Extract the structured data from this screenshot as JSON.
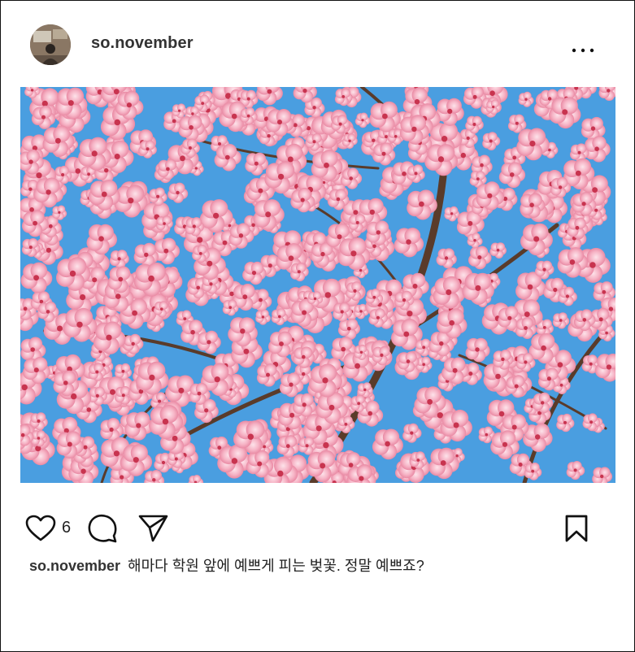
{
  "post": {
    "username": "so.november",
    "like_count": "6",
    "caption_username": "so.november",
    "caption_text": "해마다 학원 앞에 예쁘게 피는 벚꽃. 정말 예쁘죠?"
  },
  "icons": {
    "avatar": "profile-photo",
    "more": "more-horizontal-icon",
    "like": "heart-icon",
    "comment": "comment-bubble-icon",
    "share": "send-paper-plane-icon",
    "save": "bookmark-icon"
  },
  "colors": {
    "sky": "#4a9ee0",
    "blossom": "#f7b5c6",
    "blossom_dark": "#e8819c",
    "branch": "#5a3b2a"
  }
}
